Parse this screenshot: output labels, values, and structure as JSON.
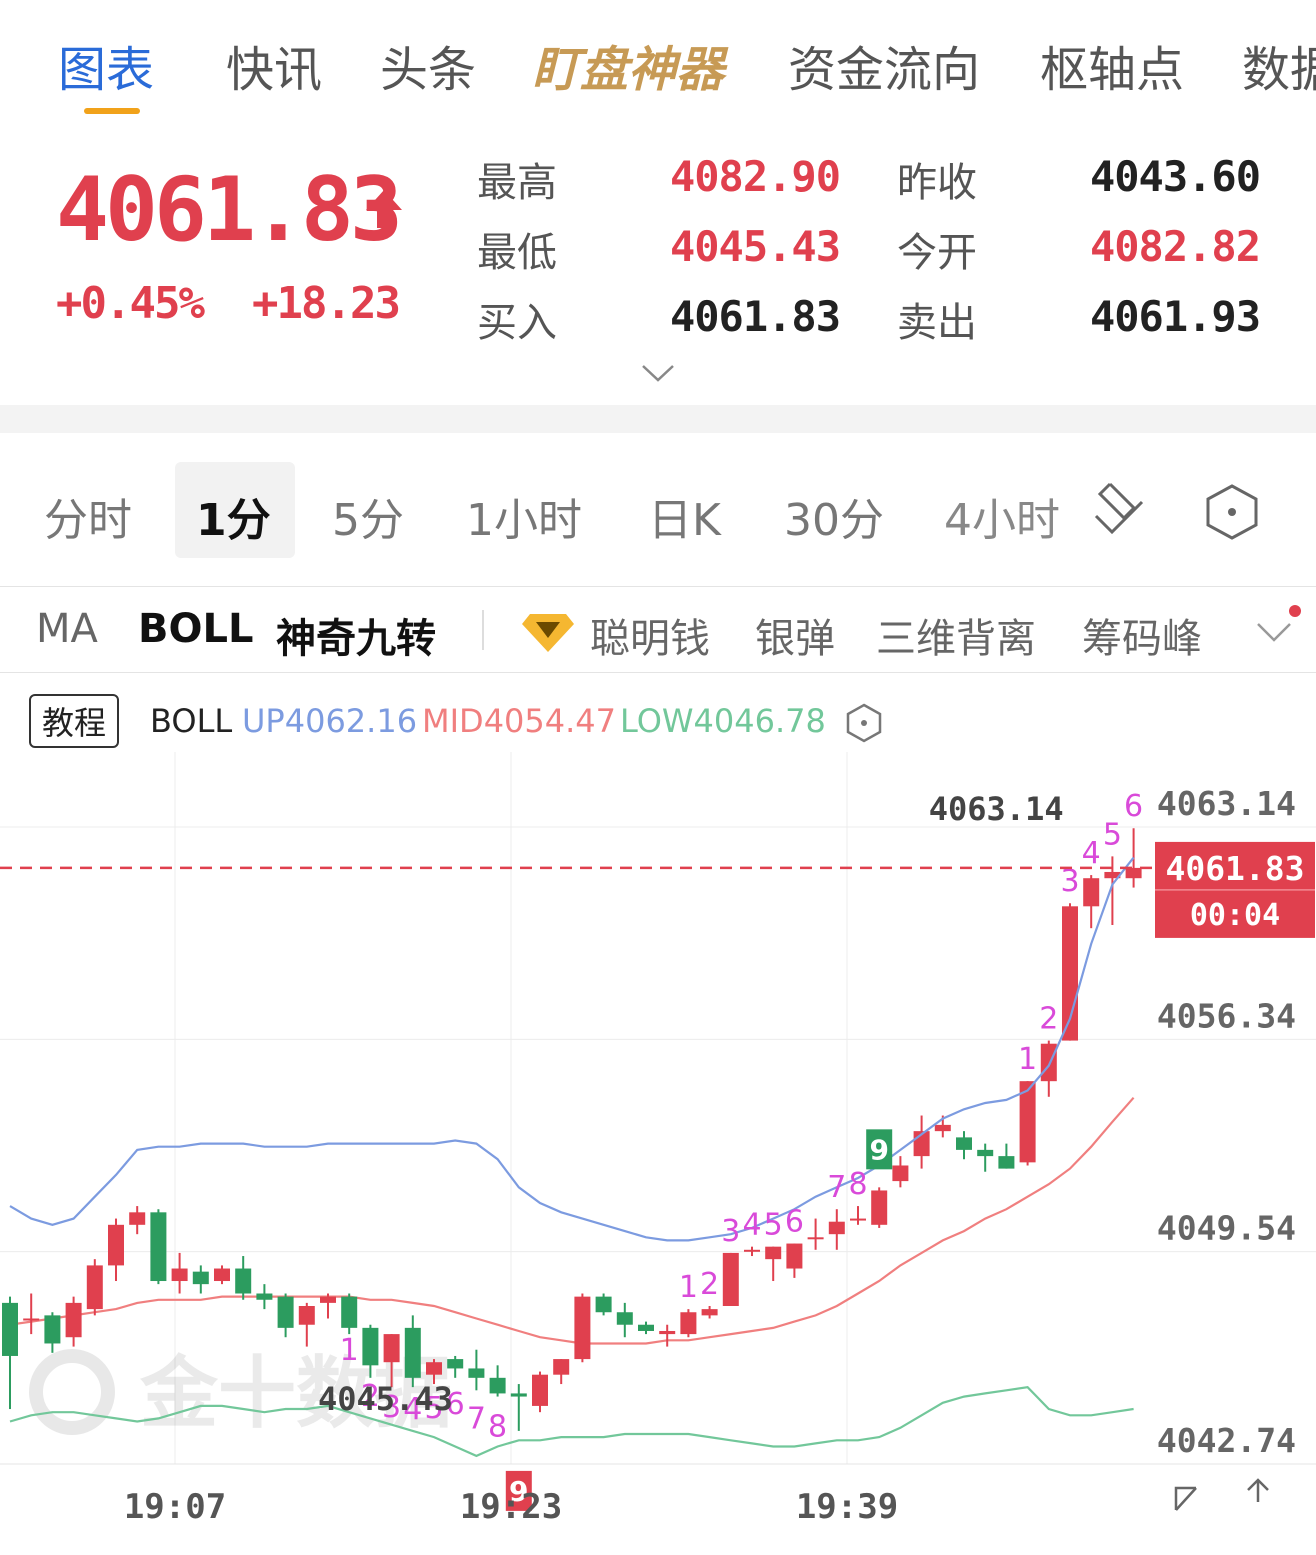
{
  "nav": {
    "tabs": [
      {
        "label": "图表",
        "active": true
      },
      {
        "label": "快讯"
      },
      {
        "label": "头条"
      },
      {
        "label": "盯盘神器",
        "highlight": true
      },
      {
        "label": "资金流向"
      },
      {
        "label": "枢轴点"
      },
      {
        "label": "数据"
      }
    ]
  },
  "quote": {
    "price": "4061.83",
    "change_pct": "+0.45%",
    "change_abs": "+18.23",
    "high_label": "最高",
    "high": "4082.90",
    "low_label": "最低",
    "low": "4045.43",
    "bid_label": "买入",
    "bid": "4061.83",
    "prev_close_label": "昨收",
    "prev_close": "4043.60",
    "open_label": "今开",
    "open": "4082.82",
    "ask_label": "卖出",
    "ask": "4061.93"
  },
  "periods": [
    "分时",
    "1分",
    "5分",
    "1小时",
    "日K",
    "30分",
    "4小时"
  ],
  "active_period": "1分",
  "indicators": {
    "items": [
      "MA",
      "BOLL",
      "神奇九转"
    ],
    "tools": [
      "聪明钱",
      "银弹",
      "三维背离",
      "筹码峰"
    ]
  },
  "legend": {
    "tutorial": "教程",
    "name": "BOLL",
    "up": "UP4062.16",
    "mid": "MID4054.47",
    "low": "LOW4046.78"
  },
  "colors": {
    "up": "#e0404e",
    "down": "#2c9c5f",
    "boll_up": "#7c9be0",
    "boll_mid": "#f07f7f",
    "boll_low": "#72c79a",
    "td": "#d94ad9",
    "accent": "#2a6bd8"
  },
  "chart_data": {
    "type": "candlestick",
    "ylim": [
      4042.74,
      4063.14
    ],
    "y_ticks": [
      "4063.14",
      "4056.34",
      "4049.54",
      "4042.74"
    ],
    "x_ticks": [
      "19:07",
      "19:23",
      "19:39"
    ],
    "last_price": "4061.83",
    "countdown": "00:04",
    "max_label": "4063.14",
    "min_label": "4045.43",
    "watermark": "金十数据",
    "candles": [
      {
        "o": 4047.9,
        "h": 4048.1,
        "l": 4044.5,
        "c": 4046.2
      },
      {
        "o": 4047.4,
        "h": 4048.2,
        "l": 4046.9,
        "c": 4047.4
      },
      {
        "o": 4047.5,
        "h": 4047.6,
        "l": 4046.3,
        "c": 4046.6
      },
      {
        "o": 4046.8,
        "h": 4048.1,
        "l": 4046.5,
        "c": 4047.9
      },
      {
        "o": 4047.7,
        "h": 4049.3,
        "l": 4047.5,
        "c": 4049.1
      },
      {
        "o": 4049.1,
        "h": 4050.6,
        "l": 4048.6,
        "c": 4050.4
      },
      {
        "o": 4050.4,
        "h": 4051.0,
        "l": 4050.1,
        "c": 4050.8
      },
      {
        "o": 4050.8,
        "h": 4050.9,
        "l": 4048.5,
        "c": 4048.6
      },
      {
        "o": 4048.6,
        "h": 4049.5,
        "l": 4048.2,
        "c": 4049.0
      },
      {
        "o": 4048.9,
        "h": 4049.1,
        "l": 4048.2,
        "c": 4048.5
      },
      {
        "o": 4048.6,
        "h": 4049.1,
        "l": 4048.5,
        "c": 4049.0
      },
      {
        "o": 4049.0,
        "h": 4049.4,
        "l": 4048.0,
        "c": 4048.2
      },
      {
        "o": 4048.2,
        "h": 4048.5,
        "l": 4047.7,
        "c": 4048.0
      },
      {
        "o": 4048.1,
        "h": 4048.2,
        "l": 4046.8,
        "c": 4047.1
      },
      {
        "o": 4047.2,
        "h": 4047.9,
        "l": 4046.5,
        "c": 4047.8
      },
      {
        "o": 4047.9,
        "h": 4048.2,
        "l": 4047.4,
        "c": 4048.1
      },
      {
        "o": 4048.1,
        "h": 4048.2,
        "l": 4046.9,
        "c": 4047.1
      },
      {
        "o": 4047.1,
        "h": 4047.2,
        "l": 4045.5,
        "c": 4045.9
      },
      {
        "o": 4046.0,
        "h": 4046.9,
        "l": 4045.2,
        "c": 4046.9
      },
      {
        "o": 4047.1,
        "h": 4047.5,
        "l": 4045.2,
        "c": 4045.5
      },
      {
        "o": 4045.6,
        "h": 4046.1,
        "l": 4045.3,
        "c": 4046.0
      },
      {
        "o": 4046.1,
        "h": 4046.2,
        "l": 4045.5,
        "c": 4045.8
      },
      {
        "o": 4045.8,
        "h": 4046.4,
        "l": 4045.1,
        "c": 4045.5
      },
      {
        "o": 4045.5,
        "h": 4045.9,
        "l": 4044.9,
        "c": 4045.0
      },
      {
        "o": 4045.0,
        "h": 4045.3,
        "l": 4043.8,
        "c": 4044.9
      },
      {
        "o": 4044.6,
        "h": 4045.7,
        "l": 4044.4,
        "c": 4045.6
      },
      {
        "o": 4045.6,
        "h": 4046.1,
        "l": 4045.3,
        "c": 4046.1
      },
      {
        "o": 4046.1,
        "h": 4048.2,
        "l": 4046.0,
        "c": 4048.1
      },
      {
        "o": 4048.1,
        "h": 4048.2,
        "l": 4047.5,
        "c": 4047.6
      },
      {
        "o": 4047.6,
        "h": 4047.9,
        "l": 4046.8,
        "c": 4047.2
      },
      {
        "o": 4047.2,
        "h": 4047.3,
        "l": 4046.9,
        "c": 4047.0
      },
      {
        "o": 4046.9,
        "h": 4047.2,
        "l": 4046.5,
        "c": 4047.0
      },
      {
        "o": 4046.9,
        "h": 4047.7,
        "l": 4046.8,
        "c": 4047.6
      },
      {
        "o": 4047.5,
        "h": 4047.8,
        "l": 4047.4,
        "c": 4047.7
      },
      {
        "o": 4047.8,
        "h": 4049.5,
        "l": 4047.8,
        "c": 4049.5
      },
      {
        "o": 4049.6,
        "h": 4049.7,
        "l": 4049.4,
        "c": 4049.6
      },
      {
        "o": 4049.3,
        "h": 4049.7,
        "l": 4048.6,
        "c": 4049.7
      },
      {
        "o": 4049.0,
        "h": 4049.8,
        "l": 4048.7,
        "c": 4049.8
      },
      {
        "o": 4050.0,
        "h": 4050.6,
        "l": 4049.6,
        "c": 4050.0
      },
      {
        "o": 4050.1,
        "h": 4050.9,
        "l": 4049.6,
        "c": 4050.5
      },
      {
        "o": 4050.6,
        "h": 4051.0,
        "l": 4050.4,
        "c": 4050.6
      },
      {
        "o": 4050.4,
        "h": 4051.6,
        "l": 4050.3,
        "c": 4051.5
      },
      {
        "o": 4051.8,
        "h": 4052.6,
        "l": 4051.6,
        "c": 4052.3
      },
      {
        "o": 4052.6,
        "h": 4053.9,
        "l": 4052.2,
        "c": 4053.4
      },
      {
        "o": 4053.4,
        "h": 4053.9,
        "l": 4053.2,
        "c": 4053.6
      },
      {
        "o": 4053.2,
        "h": 4053.4,
        "l": 4052.5,
        "c": 4052.8
      },
      {
        "o": 4052.8,
        "h": 4053.0,
        "l": 4052.1,
        "c": 4052.6
      },
      {
        "o": 4052.6,
        "h": 4053.0,
        "l": 4052.2,
        "c": 4052.2
      },
      {
        "o": 4052.4,
        "h": 4055.0,
        "l": 4052.3,
        "c": 4055.0
      },
      {
        "o": 4055.0,
        "h": 4056.3,
        "l": 4054.5,
        "c": 4056.2
      },
      {
        "o": 4056.3,
        "h": 4060.7,
        "l": 4056.3,
        "c": 4060.6
      },
      {
        "o": 4060.6,
        "h": 4061.6,
        "l": 4059.9,
        "c": 4061.5
      },
      {
        "o": 4061.5,
        "h": 4062.2,
        "l": 4060.0,
        "c": 4061.7
      },
      {
        "o": 4061.5,
        "h": 4063.1,
        "l": 4061.2,
        "c": 4061.83
      }
    ],
    "boll_up": [
      4051.0,
      4050.6,
      4050.4,
      4050.6,
      4051.3,
      4052.0,
      4052.8,
      4052.9,
      4052.9,
      4053.0,
      4053.0,
      4053.0,
      4052.9,
      4052.9,
      4052.9,
      4053.0,
      4053.0,
      4053.0,
      4053.0,
      4053.0,
      4053.0,
      4053.1,
      4053.0,
      4052.5,
      4051.6,
      4051.1,
      4050.8,
      4050.6,
      4050.4,
      4050.2,
      4050.0,
      4049.9,
      4049.9,
      4050.0,
      4050.1,
      4050.3,
      4050.6,
      4050.9,
      4051.3,
      4051.6,
      4051.9,
      4052.3,
      4052.8,
      4053.3,
      4053.8,
      4054.1,
      4054.3,
      4054.4,
      4054.7,
      4055.5,
      4057.0,
      4059.4,
      4061.3,
      4062.16
    ],
    "boll_mid": [
      4047.2,
      4047.3,
      4047.4,
      4047.5,
      4047.6,
      4047.7,
      4047.9,
      4048.0,
      4048.0,
      4048.0,
      4048.1,
      4048.1,
      4048.1,
      4048.1,
      4048.1,
      4048.1,
      4048.1,
      4048.0,
      4048.0,
      4047.9,
      4047.8,
      4047.6,
      4047.4,
      4047.2,
      4047.0,
      4046.8,
      4046.7,
      4046.6,
      4046.6,
      4046.6,
      4046.6,
      4046.7,
      4046.7,
      4046.8,
      4046.9,
      4047.0,
      4047.1,
      4047.3,
      4047.5,
      4047.8,
      4048.2,
      4048.6,
      4049.1,
      4049.5,
      4049.9,
      4050.2,
      4050.6,
      4050.9,
      4051.3,
      4051.7,
      4052.2,
      4052.9,
      4053.7,
      4054.47
    ],
    "boll_low": [
      4044.1,
      4044.3,
      4044.4,
      4044.4,
      4044.3,
      4044.2,
      4044.1,
      4044.2,
      4044.4,
      4044.6,
      4044.6,
      4044.5,
      4044.4,
      4044.5,
      4044.5,
      4044.6,
      4044.4,
      4044.2,
      4044.0,
      4043.8,
      4043.6,
      4043.3,
      4043.0,
      4043.3,
      4043.5,
      4043.5,
      4043.6,
      4043.6,
      4043.6,
      4043.7,
      4043.7,
      4043.7,
      4043.7,
      4043.6,
      4043.5,
      4043.4,
      4043.3,
      4043.3,
      4043.4,
      4043.5,
      4043.5,
      4043.6,
      4043.9,
      4044.3,
      4044.7,
      4044.9,
      4045.0,
      4045.1,
      4045.2,
      4044.5,
      4044.3,
      4044.3,
      4044.4,
      4044.5
    ],
    "td_buy": [
      {
        "i": 16,
        "n": "1"
      },
      {
        "i": 17,
        "n": "2"
      },
      {
        "i": 18,
        "n": "3"
      },
      {
        "i": 19,
        "n": "4"
      },
      {
        "i": 20,
        "n": "5"
      },
      {
        "i": 21,
        "n": "6"
      },
      {
        "i": 22,
        "n": "7"
      },
      {
        "i": 23,
        "n": "8"
      },
      {
        "i": 24,
        "n": "9"
      }
    ],
    "td_sell": [
      {
        "i": 32,
        "n": "1"
      },
      {
        "i": 33,
        "n": "2"
      },
      {
        "i": 34,
        "n": "3"
      },
      {
        "i": 35,
        "n": "4"
      },
      {
        "i": 36,
        "n": "5"
      },
      {
        "i": 37,
        "n": "6"
      },
      {
        "i": 39,
        "n": "7"
      },
      {
        "i": 40,
        "n": "8"
      },
      {
        "i": 41,
        "n": "9"
      },
      {
        "i": 48,
        "n": "1"
      },
      {
        "i": 49,
        "n": "2"
      },
      {
        "i": 50,
        "n": "3"
      },
      {
        "i": 51,
        "n": "4"
      },
      {
        "i": 52,
        "n": "5"
      },
      {
        "i": 53,
        "n": "6"
      }
    ]
  }
}
